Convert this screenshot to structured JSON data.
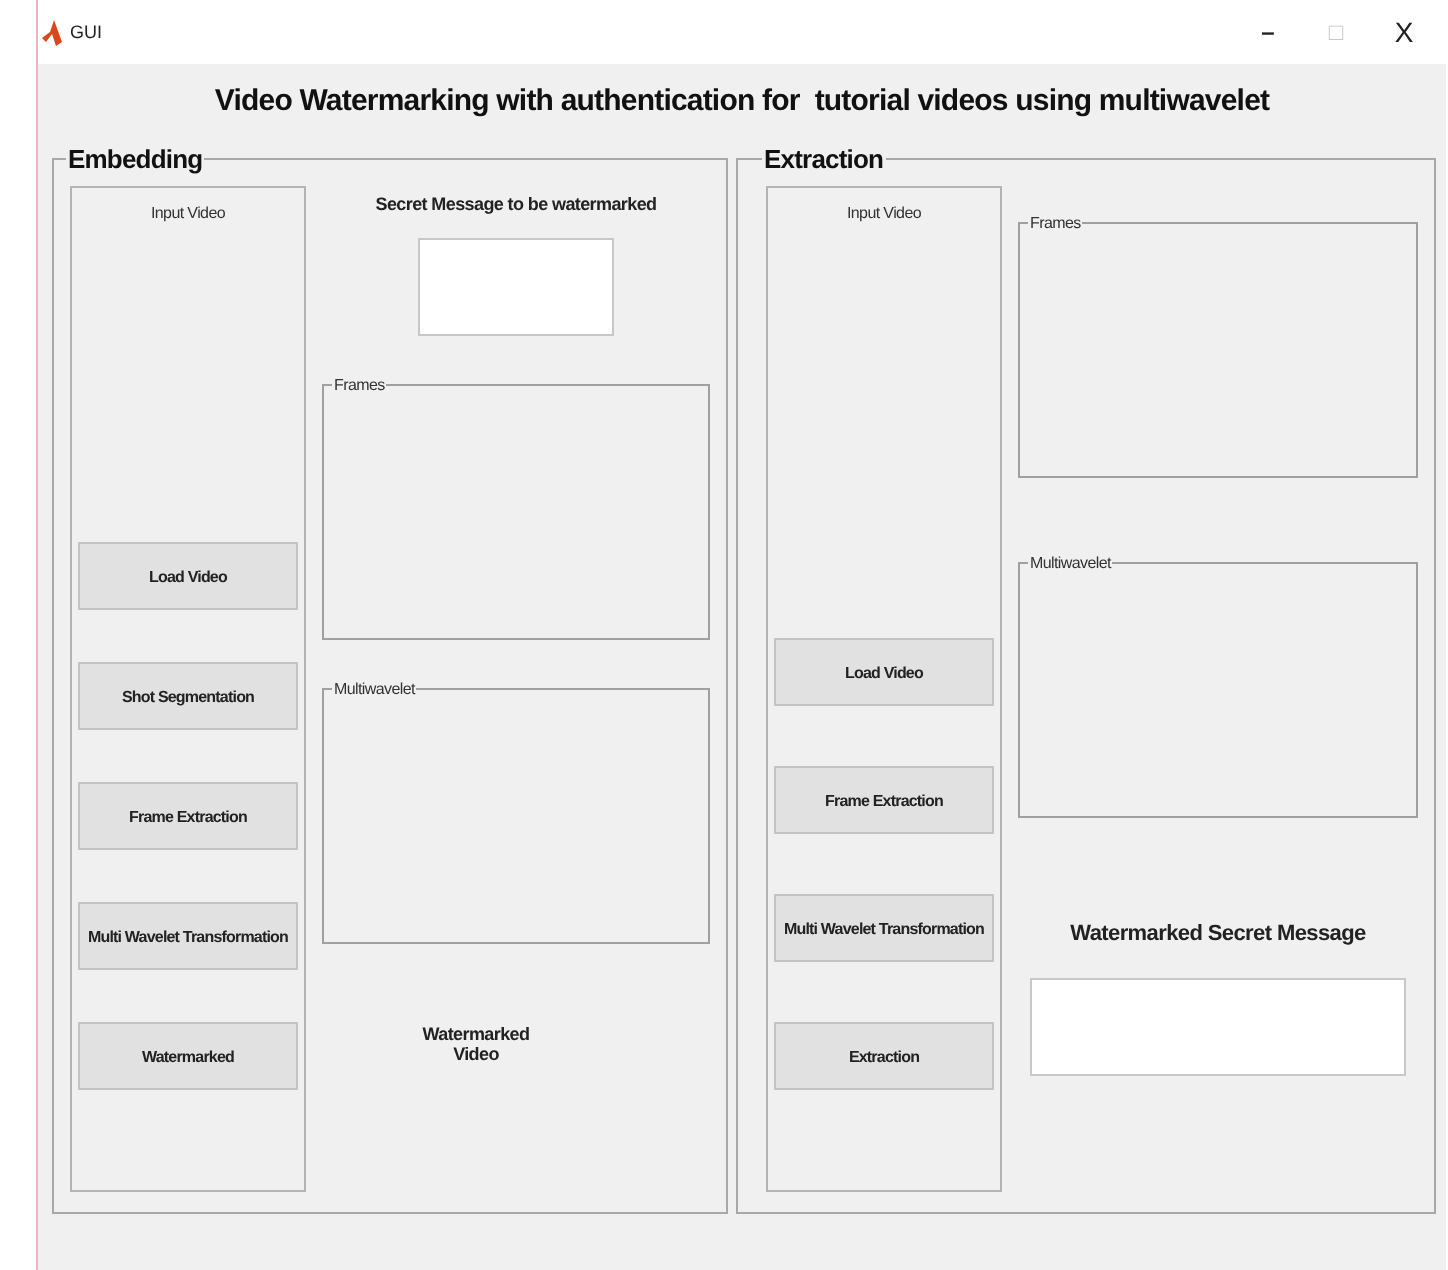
{
  "window": {
    "title": "GUI",
    "controls": [
      {
        "kind": "minimize",
        "label": "–",
        "disabled": false
      },
      {
        "kind": "maximize",
        "label": "□",
        "disabled": true
      },
      {
        "kind": "close",
        "label": "X",
        "disabled": false
      }
    ]
  },
  "heading": "Video Watermarking with authentication for  tutorial videos using multiwavelet",
  "panels": [
    {
      "title": "Embedding",
      "input_video": {
        "label": "Input Video",
        "buttons": [
          "Load Video",
          "Shot Segmentation",
          "Frame Extraction",
          "Multi Wavelet Transformation",
          "Watermarked"
        ]
      },
      "items": [
        {
          "kind": "label",
          "text": "Secret Message to be watermarked"
        },
        {
          "kind": "textbox"
        },
        {
          "kind": "axes",
          "title": "Frames"
        },
        {
          "kind": "axes",
          "title": "Multiwavelet"
        },
        {
          "kind": "caption",
          "text": "Watermarked\nVideo"
        }
      ]
    },
    {
      "title": "Extraction",
      "input_video": {
        "label": "Input Video",
        "buttons": [
          "Load Video",
          "Frame Extraction",
          "Multi Wavelet Transformation",
          "Extraction"
        ]
      },
      "items": [
        {
          "kind": "axes",
          "title": "Frames"
        },
        {
          "kind": "axes",
          "title": "Multiwavelet"
        },
        {
          "kind": "heading",
          "text": "Watermarked Secret Message"
        },
        {
          "kind": "wide-textbox"
        }
      ]
    }
  ]
}
